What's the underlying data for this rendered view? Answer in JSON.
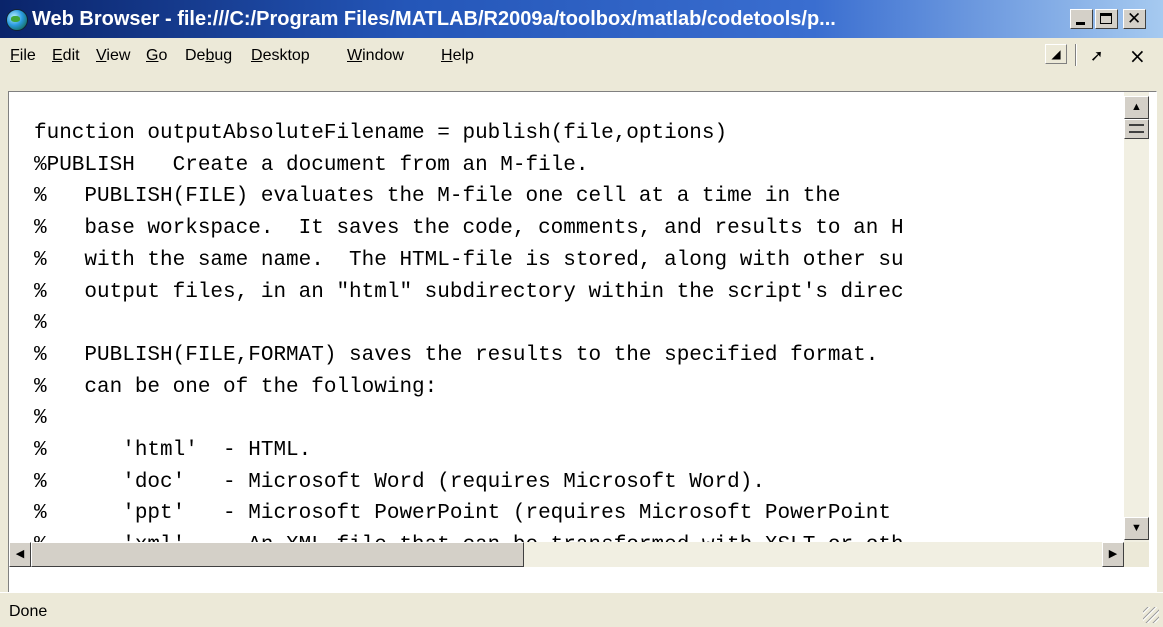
{
  "window": {
    "title": "Web Browser - file:///C:/Program Files/MATLAB/R2009a/toolbox/matlab/codetools/p...",
    "controls": {
      "minimize": "minimize",
      "maximize": "maximize",
      "close": "✕"
    }
  },
  "menubar": {
    "items": [
      {
        "label": "File",
        "accel": "F"
      },
      {
        "label": "Edit",
        "accel": "E"
      },
      {
        "label": "View",
        "accel": "V"
      },
      {
        "label": "Go",
        "accel": "G"
      },
      {
        "label": "Debug",
        "accel": "b"
      },
      {
        "label": "Desktop",
        "accel": "D"
      },
      {
        "label": "Window",
        "accel": "W"
      },
      {
        "label": "Help",
        "accel": "H"
      }
    ],
    "dock_icon": "dock-icon",
    "undock_glyph": "➚",
    "close_glyph": "×"
  },
  "content": {
    "lines": [
      "function outputAbsoluteFilename = publish(file,options)",
      "%PUBLISH   Create a document from an M-file.",
      "%   PUBLISH(FILE) evaluates the M-file one cell at a time in the",
      "%   base workspace.  It saves the code, comments, and results to an H",
      "%   with the same name.  The HTML-file is stored, along with other su",
      "%   output files, in an \"html\" subdirectory within the script's direc",
      "%",
      "%   PUBLISH(FILE,FORMAT) saves the results to the specified format.",
      "%   can be one of the following:",
      "%",
      "%      'html'  - HTML.",
      "%      'doc'   - Microsoft Word (requires Microsoft Word).",
      "%      'ppt'   - Microsoft PowerPoint (requires Microsoft PowerPoint",
      "%      'xml'   - An XML file that can be transformed with XSLT or oth"
    ]
  },
  "scrollbars": {
    "up_arrow": "▲",
    "down_arrow": "▼",
    "left_arrow": "◀",
    "right_arrow": "▶"
  },
  "status": {
    "text": "Done"
  }
}
